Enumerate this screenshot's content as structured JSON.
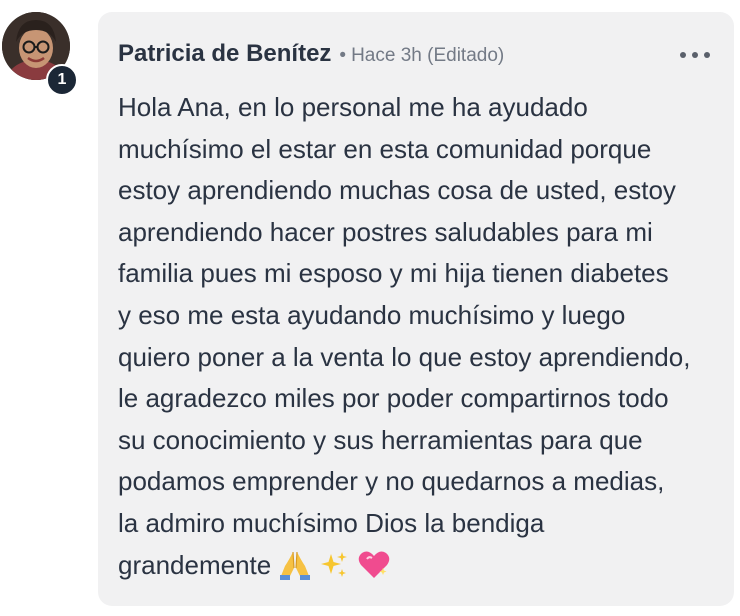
{
  "comment": {
    "author": "Patricia de Benítez",
    "separator": "•",
    "time": "Hace 3h",
    "edited": "(Editado)",
    "level": "1",
    "body": "Hola Ana, en lo personal me ha ayudado\nmuchísimo el estar en esta comunidad porque\nestoy aprendiendo muchas cosa de usted, estoy\naprendiendo hacer postres saludables para mi\nfamilia pues mi esposo y mi hija tienen diabetes\ny eso me esta ayudando muchísimo y luego\nquiero poner a la venta lo que estoy aprendiendo,\nle agradezco miles por poder compartirnos todo\nsu conocimiento y sus herramientas para que\npodamos emprender y no quedarnos a medias,\nla admiro muchísimo Dios la bendiga\ngrandemente",
    "emojis": [
      "folded-hands-icon",
      "sparkles-icon",
      "sparkling-heart-icon"
    ]
  },
  "colors": {
    "bubble": "#f1f1f2",
    "author": "#2a3342",
    "meta": "#737a86",
    "badge": "#1b2736"
  }
}
